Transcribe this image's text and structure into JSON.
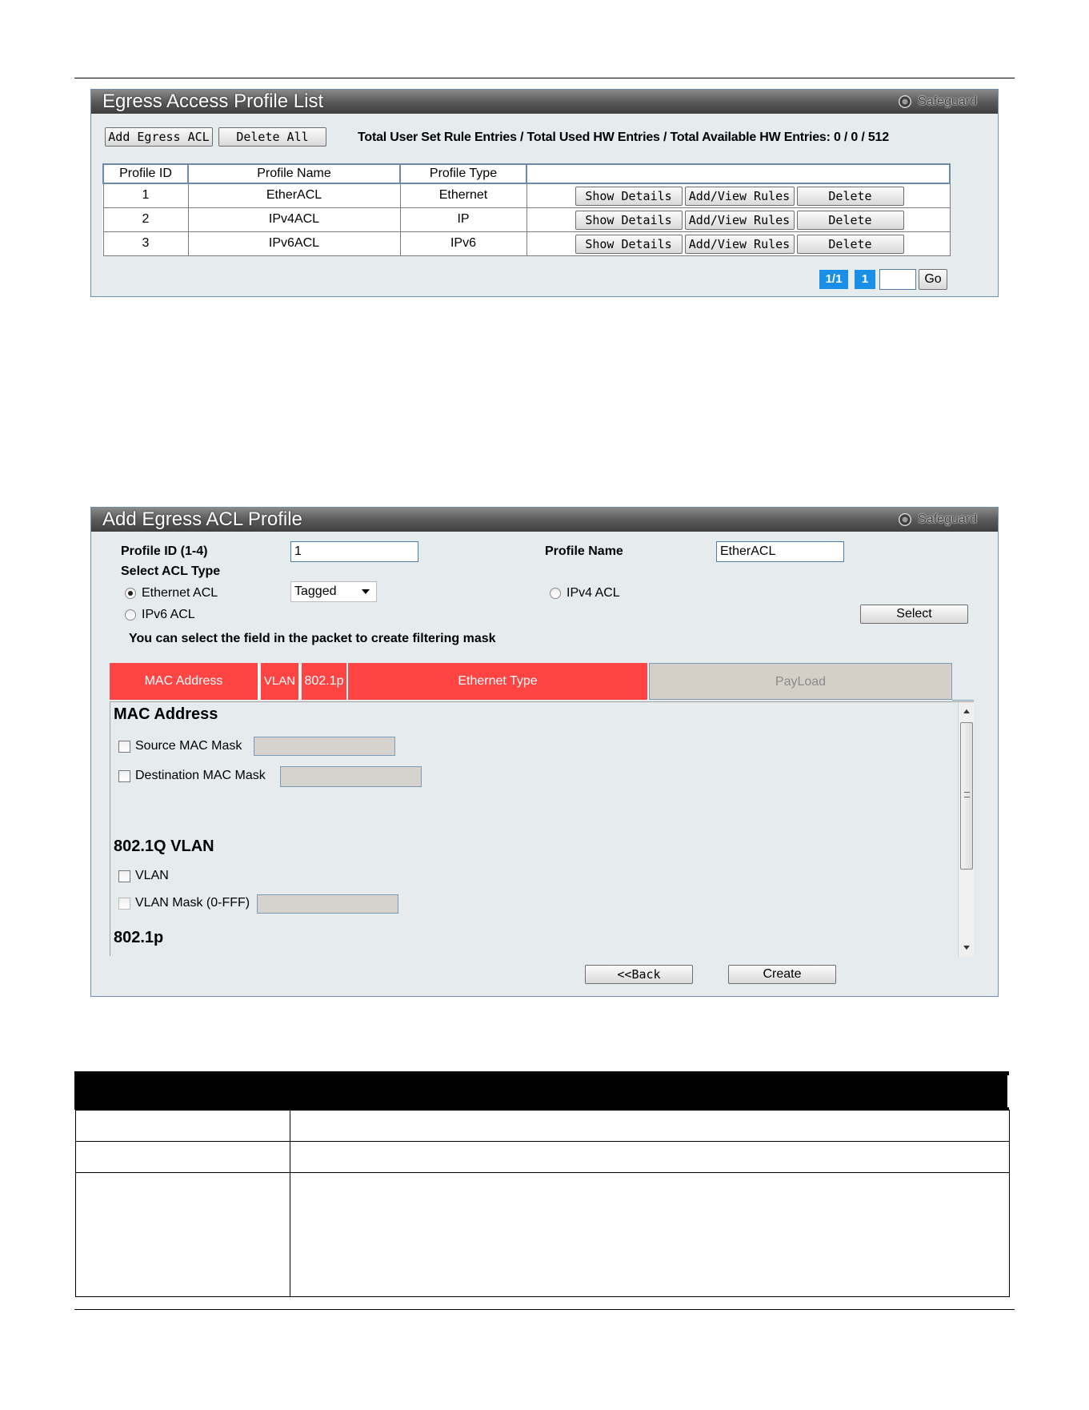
{
  "panel1": {
    "title": "Egress Access Profile List",
    "safeguard": "Safeguard",
    "add_button": "Add Egress ACL",
    "delete_all_button": "Delete All",
    "total_text": "Total User Set Rule Entries / Total Used HW Entries / Total Available HW Entries: 0 / 0 / 512",
    "columns": [
      "Profile ID",
      "Profile Name",
      "Profile Type"
    ],
    "rows": [
      {
        "id": "1",
        "name": "EtherACL",
        "type": "Ethernet"
      },
      {
        "id": "2",
        "name": "IPv4ACL",
        "type": "IP"
      },
      {
        "id": "3",
        "name": "IPv6ACL",
        "type": "IPv6"
      }
    ],
    "row_buttons": {
      "show": "Show Details",
      "add_view": "Add/View Rules",
      "delete": "Delete"
    },
    "pagination": {
      "pages": "1/1",
      "current": "1",
      "go": "Go"
    }
  },
  "panel2": {
    "title": "Add Egress ACL Profile",
    "safeguard": "Safeguard",
    "profile_id_label": "Profile ID (1-4)",
    "profile_id_value": "1",
    "profile_name_label": "Profile Name",
    "profile_name_value": "EtherACL",
    "select_acl_type_label": "Select ACL Type",
    "ethernet_acl": "Ethernet ACL",
    "tagged_value": "Tagged",
    "ipv4_acl": "IPv4 ACL",
    "ipv6_acl": "IPv6 ACL",
    "select_button": "Select",
    "hint": "You can select the field in the packet to create filtering mask",
    "fields": [
      "MAC Address",
      "VLAN",
      "802.1p",
      "Ethernet Type",
      "PayLoad"
    ],
    "mac_heading": "MAC Address",
    "source_mac_mask": "Source MAC Mask",
    "dest_mac_mask": "Destination MAC Mask",
    "vlan_heading": "802.1Q VLAN",
    "vlan_label": "VLAN",
    "vlan_mask_label": "VLAN Mask (0-FFF)",
    "dot1p_heading": "802.1p",
    "back_button": "<<Back",
    "create_button": "Create"
  }
}
